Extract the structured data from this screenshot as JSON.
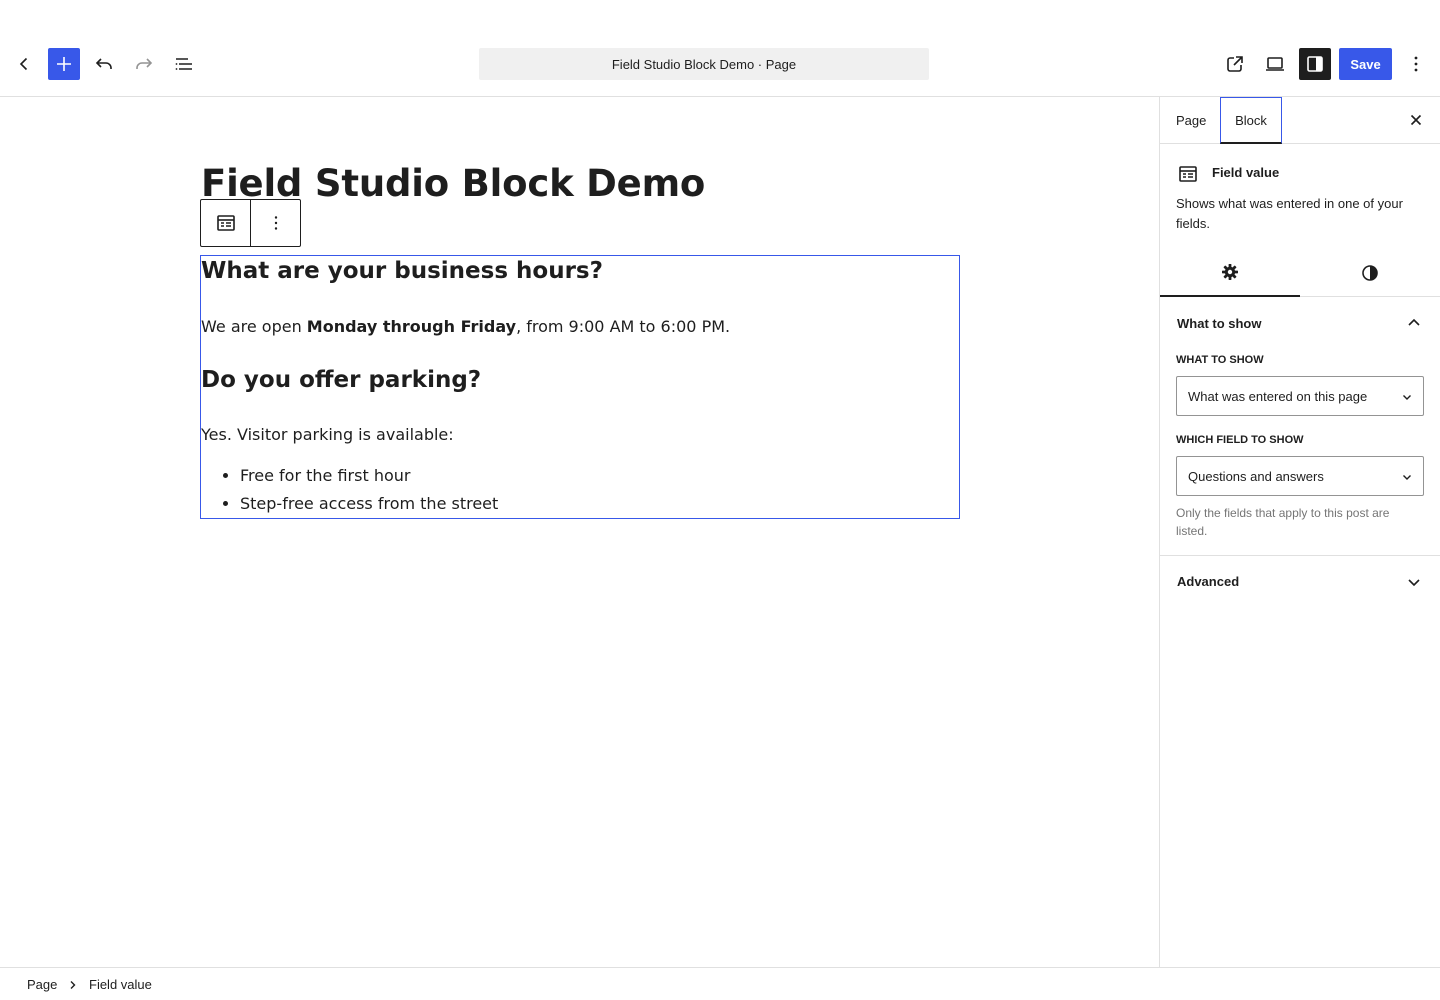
{
  "toolbar": {
    "document_title": "Field Studio Block Demo · Page",
    "save_label": "Save",
    "accent_color": "#3858e9",
    "icons": [
      "chevron-left-icon",
      "plus-icon",
      "undo-icon",
      "redo-icon",
      "list-view-icon",
      "external-link-icon",
      "desktop-view-icon",
      "sidebar-icon",
      "more-vertical-icon"
    ]
  },
  "canvas": {
    "post_title": "Field Studio Block Demo",
    "block": {
      "q1": "What are your business hours?",
      "a1_pre": "We are open ",
      "a1_bold": "Monday through Friday",
      "a1_post": ", from 9:00 AM to 6:00 PM.",
      "q2": "Do you offer parking?",
      "a2": "Yes. Visitor parking is available:",
      "a2_list": [
        "Free for the first hour",
        "Step-free access from the street"
      ]
    }
  },
  "sidebar": {
    "tabs": {
      "page": "Page",
      "block": "Block"
    },
    "block_card": {
      "title": "Field value",
      "description": "Shows what was entered in one of your fields."
    },
    "panel_what": {
      "title": "What to show",
      "what_label": "What to show",
      "what_value": "What was entered on this page",
      "which_label": "Which field to show",
      "which_value": "Questions and answers",
      "help": "Only the fields that apply to this post are listed."
    },
    "panel_advanced": {
      "title": "Advanced"
    }
  },
  "footer": {
    "crumb_page": "Page",
    "crumb_current": "Field value"
  }
}
